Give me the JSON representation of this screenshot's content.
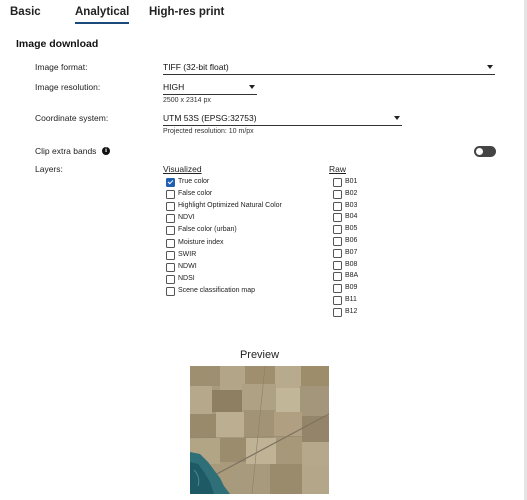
{
  "tabs": [
    {
      "label": "Basic",
      "active": false
    },
    {
      "label": "Analytical",
      "active": true
    },
    {
      "label": "High-res print",
      "active": false
    }
  ],
  "section_title": "Image download",
  "fields": {
    "image_format": {
      "label": "Image format:",
      "value": "TIFF (32-bit float)"
    },
    "image_resolution": {
      "label": "Image resolution:",
      "value": "HIGH",
      "hint": "2500 x 2314 px"
    },
    "coordinate_system": {
      "label": "Coordinate system:",
      "value": "UTM 53S (EPSG:32753)",
      "hint": "Projected resolution: 10 m/px"
    },
    "clip_extra_bands": {
      "label": "Clip extra bands",
      "info_icon": "info-icon",
      "enabled": false
    }
  },
  "layers": {
    "label": "Layers:",
    "visualized": {
      "header": "Visualized",
      "items": [
        {
          "label": "True color",
          "checked": true
        },
        {
          "label": "False color",
          "checked": false
        },
        {
          "label": "Highlight Optimized Natural Color",
          "checked": false
        },
        {
          "label": "NDVI",
          "checked": false
        },
        {
          "label": "False color (urban)",
          "checked": false
        },
        {
          "label": "Moisture index",
          "checked": false
        },
        {
          "label": "SWIR",
          "checked": false
        },
        {
          "label": "NDWI",
          "checked": false
        },
        {
          "label": "NDSI",
          "checked": false
        },
        {
          "label": "Scene classification map",
          "checked": false
        }
      ]
    },
    "raw": {
      "header": "Raw",
      "items": [
        {
          "label": "B01",
          "checked": false
        },
        {
          "label": "B02",
          "checked": false
        },
        {
          "label": "B03",
          "checked": false
        },
        {
          "label": "B04",
          "checked": false
        },
        {
          "label": "B05",
          "checked": false
        },
        {
          "label": "B06",
          "checked": false
        },
        {
          "label": "B07",
          "checked": false
        },
        {
          "label": "B08",
          "checked": false
        },
        {
          "label": "B8A",
          "checked": false
        },
        {
          "label": "B09",
          "checked": false
        },
        {
          "label": "B11",
          "checked": false
        },
        {
          "label": "B12",
          "checked": false
        }
      ]
    }
  },
  "preview": {
    "title": "Preview"
  },
  "colors": {
    "accent": "#1f5fb0",
    "tab_underline": "#1a4a7a",
    "toggle_off": "#444444"
  }
}
